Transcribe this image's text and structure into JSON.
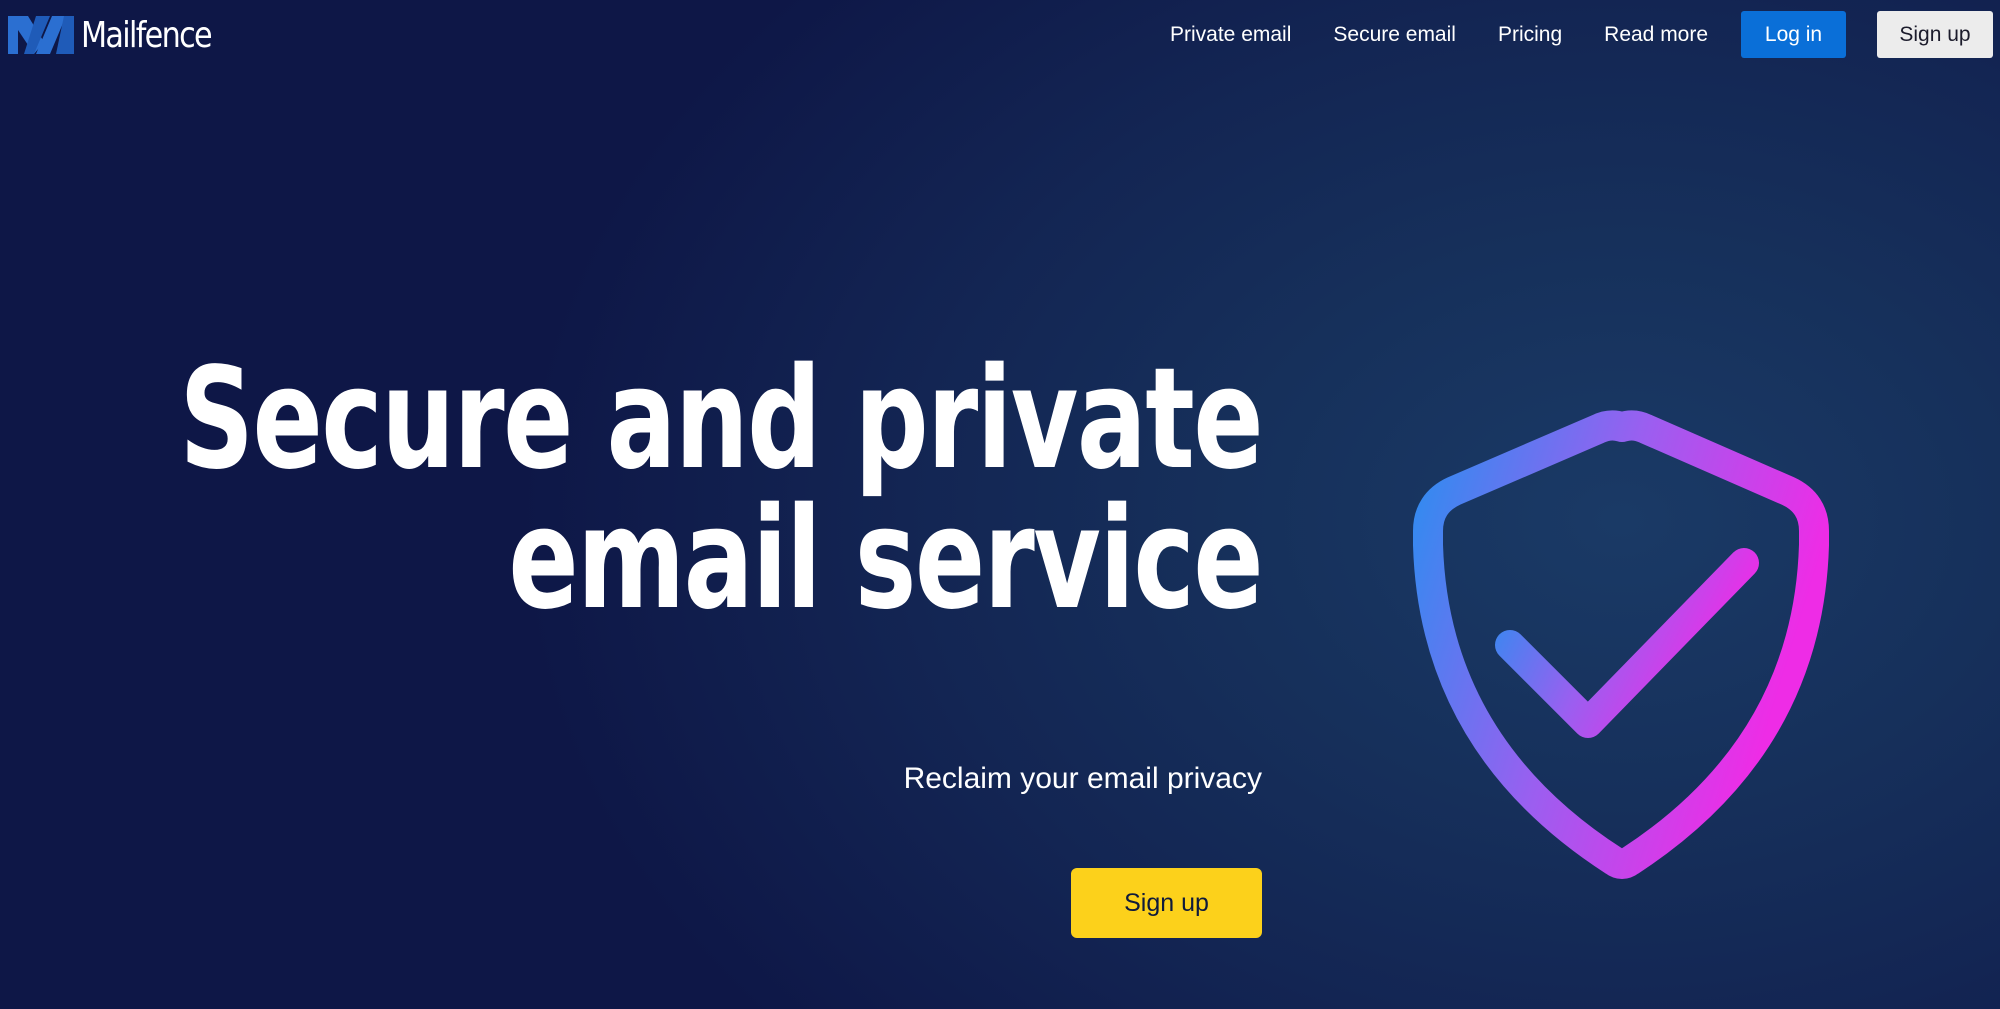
{
  "header": {
    "brand_name": "Mailfence",
    "nav": [
      {
        "label": "Private email"
      },
      {
        "label": "Secure email"
      },
      {
        "label": "Pricing"
      },
      {
        "label": "Read more"
      }
    ],
    "login_label": "Log in",
    "signup_label": "Sign up"
  },
  "hero": {
    "title_line1": "Secure and private",
    "title_line2": "email service",
    "subtitle": "Reclaim your email privacy",
    "cta_label": "Sign up",
    "illustration": "shield-check-icon"
  },
  "colors": {
    "background": "#132553",
    "login_button": "#0a6fd8",
    "signup_button": "#ececec",
    "cta_button": "#fcd11b",
    "shield_gradient_start": "#2f8cf0",
    "shield_gradient_end": "#ee2ce6",
    "logo": "#2b6fd1"
  }
}
